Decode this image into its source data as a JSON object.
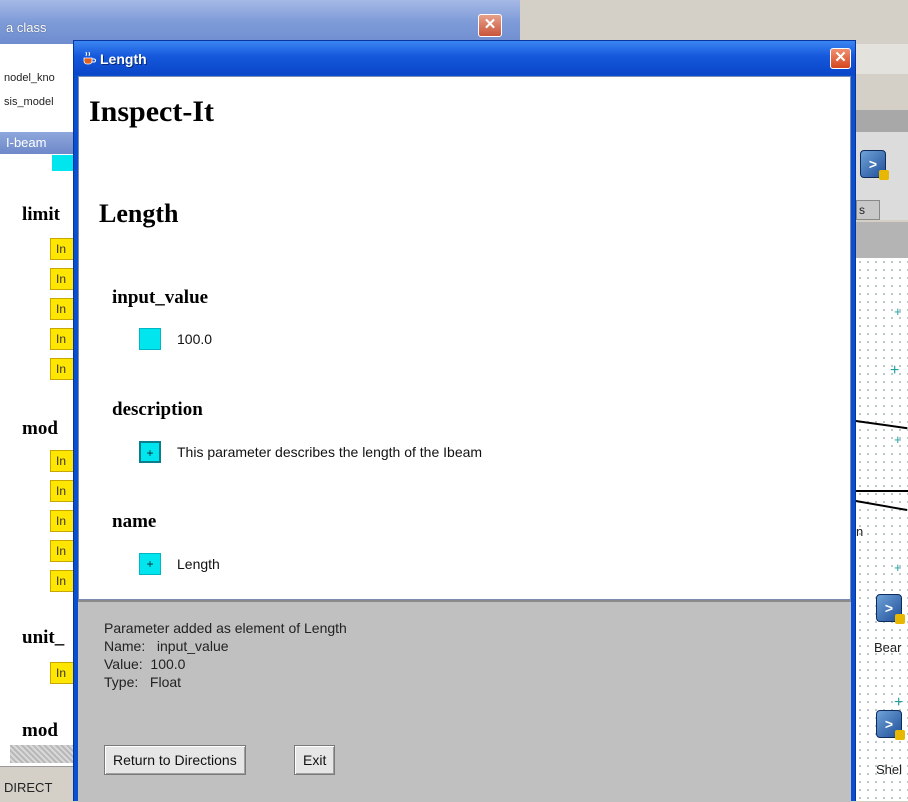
{
  "background": {
    "window_title": "a class",
    "tree_items": [
      "nodel_kno",
      "sis_model",
      ""
    ],
    "ibeam_tab": "I-beam",
    "section_labels": [
      "limit",
      "mod",
      "unit_",
      "mod"
    ],
    "yellow_label": "In",
    "status_text": "DIRECT",
    "right_tab_label": "s",
    "canvas_labels": [
      "n",
      "Bear",
      "Shel"
    ]
  },
  "dialog": {
    "title": "Length",
    "heading": "Inspect-It",
    "object_name": "Length",
    "parameters": [
      {
        "label": "input_value",
        "value": "100.0",
        "button": ""
      },
      {
        "label": "description",
        "value": "This parameter describes the length of the Ibeam",
        "button": "+"
      },
      {
        "label": "name",
        "value": "Length",
        "button": "+"
      }
    ],
    "message": {
      "line1": "Parameter added as element of Length",
      "line2": "Name:   input_value",
      "line3": "Value:  100.0",
      "line4": "Type:   Float"
    },
    "buttons": {
      "return": "Return to Directions",
      "exit": "Exit"
    },
    "close_glyph": "✕"
  },
  "colors": {
    "titlebar_blue": "#0a4fcf",
    "cyan_button": "#00e5ee",
    "yellow_button": "#ffe600",
    "panel_gray": "#c0c0c0"
  }
}
